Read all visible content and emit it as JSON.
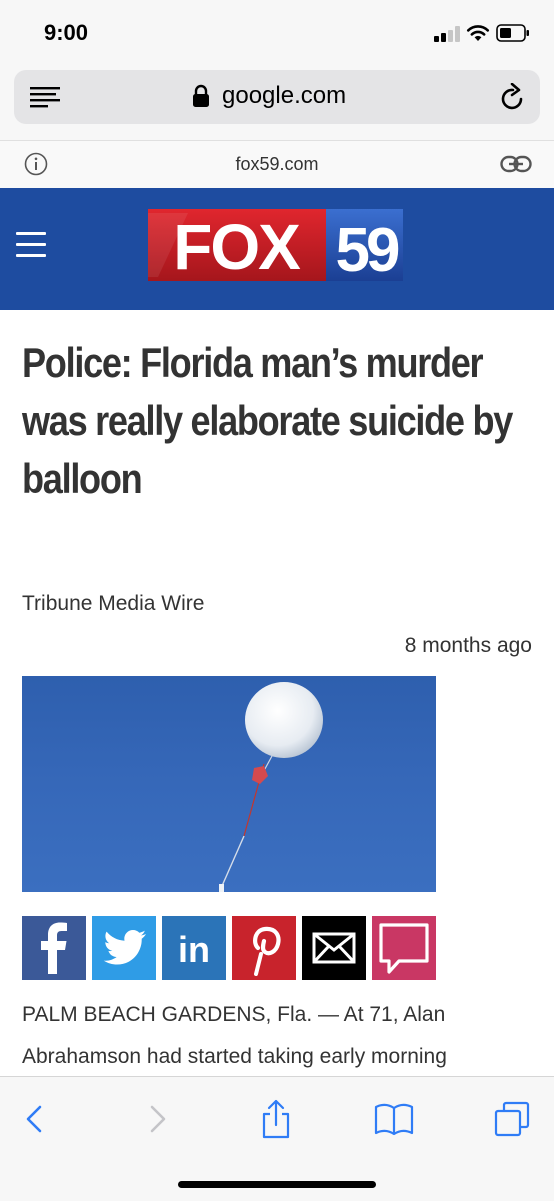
{
  "status_bar": {
    "time": "9:00"
  },
  "browser": {
    "url": "google.com",
    "amp_domain": "fox59.com"
  },
  "site": {
    "logo_text": "FOX 59"
  },
  "article": {
    "headline": "Police: Florida man’s murder was really elaborate suicide by balloon",
    "byline": "Tribune Media Wire",
    "timestamp": "8 months ago",
    "body_line_1": "PALM BEACH GARDENS, Fla. — At 71, Alan",
    "body_line_2": "Abrahamson had started taking early morning"
  },
  "share_buttons": [
    "facebook",
    "twitter",
    "linkedin",
    "pinterest",
    "email",
    "comment"
  ],
  "colors": {
    "brand_blue": "#1e4ca0",
    "facebook": "#3b5998",
    "twitter": "#2f9ce6",
    "linkedin": "#2b74b8",
    "pinterest": "#c8232c",
    "email": "#000000",
    "comment": "#c93764",
    "ios_blue": "#2f7cf6"
  }
}
